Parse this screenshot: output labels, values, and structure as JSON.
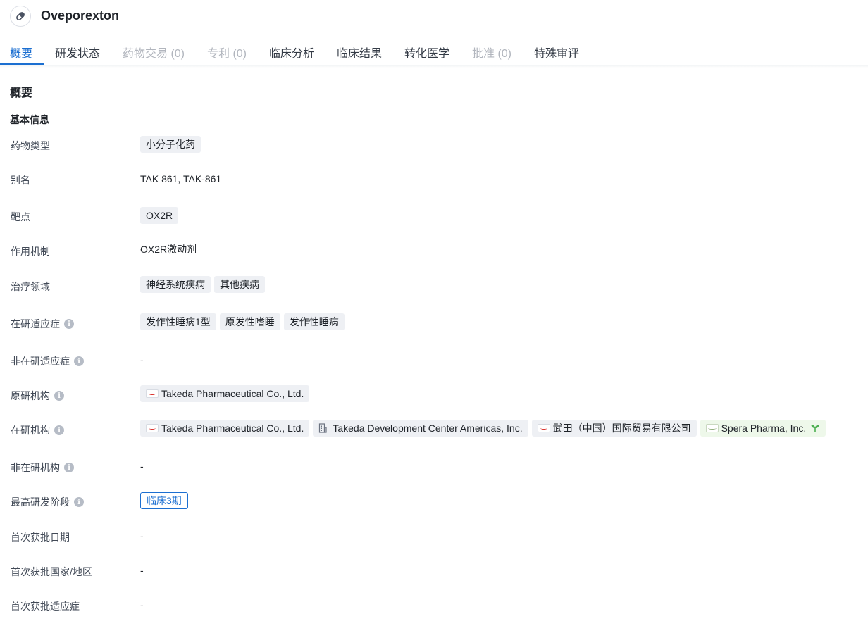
{
  "header": {
    "title": "Oveporexton",
    "icon": "pill-icon"
  },
  "tabs": [
    {
      "label": "概要",
      "state": "active"
    },
    {
      "label": "研发状态",
      "state": "normal"
    },
    {
      "label": "药物交易 (0)",
      "state": "disabled"
    },
    {
      "label": "专利 (0)",
      "state": "disabled"
    },
    {
      "label": "临床分析",
      "state": "normal"
    },
    {
      "label": "临床结果",
      "state": "normal"
    },
    {
      "label": "转化医学",
      "state": "normal"
    },
    {
      "label": "批准 (0)",
      "state": "disabled"
    },
    {
      "label": "特殊审评",
      "state": "normal"
    }
  ],
  "section": {
    "title": "概要",
    "subtitle": "基本信息"
  },
  "fields": {
    "drug_type": {
      "label": "药物类型",
      "tags": [
        "小分子化药"
      ]
    },
    "alias": {
      "label": "别名",
      "value": "TAK 861,  TAK-861"
    },
    "target": {
      "label": "靶点",
      "tags": [
        "OX2R"
      ]
    },
    "mechanism": {
      "label": "作用机制",
      "value": "OX2R激动剂"
    },
    "therapeutic_area": {
      "label": "治疗领域",
      "tags": [
        "神经系统疾病",
        "其他疾病"
      ]
    },
    "active_indications": {
      "label": "在研适应症",
      "tags": [
        "发作性睡病1型",
        "原发性嗜睡",
        "发作性睡病"
      ]
    },
    "inactive_indications": {
      "label": "非在研适应症",
      "value": "-"
    },
    "originator": {
      "label": "原研机构",
      "orgs": [
        "Takeda Pharmaceutical Co., Ltd."
      ]
    },
    "active_orgs": {
      "label": "在研机构",
      "orgs": [
        "Takeda Pharmaceutical Co., Ltd.",
        "Takeda Development Center Americas, Inc.",
        "武田（中国）国际贸易有限公司",
        "Spera Pharma, Inc."
      ]
    },
    "inactive_orgs": {
      "label": "非在研机构",
      "value": "-"
    },
    "highest_phase": {
      "label": "最高研发阶段",
      "value": "临床3期"
    },
    "first_approval_date": {
      "label": "首次获批日期",
      "value": "-"
    },
    "first_approval_country": {
      "label": "首次获批国家/地区",
      "value": "-"
    },
    "first_approval_indication": {
      "label": "首次获批适应症",
      "value": "-"
    }
  },
  "colors": {
    "accent": "#1c6fd1",
    "tag_bg": "#eef0f4",
    "green_tag_bg": "#eef8ea",
    "disabled": "#b1b5bd"
  }
}
